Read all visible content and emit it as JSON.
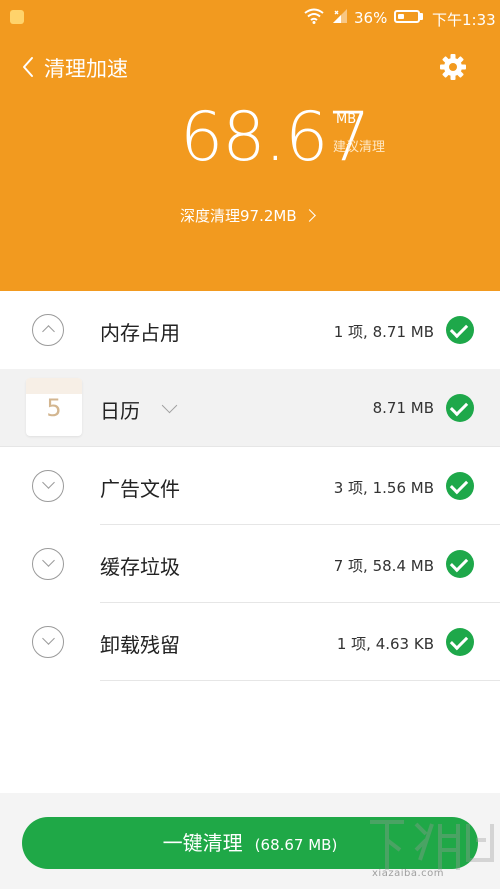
{
  "status_bar": {
    "battery": "36%",
    "battery_level": 0.36,
    "time": "下午1:33"
  },
  "header": {
    "title": "清理加速",
    "amount": "68.67",
    "unit": "MB",
    "suggestion": "建议清理",
    "deep_clean": "深度清理97.2MB"
  },
  "items": [
    {
      "label": "内存占用",
      "meta": "1 项, 8.71 MB",
      "expanded": true
    },
    {
      "label": "日历",
      "meta": "8.71  MB",
      "sub": true,
      "icon_text": "5"
    },
    {
      "label": "广告文件",
      "meta": "3 项, 1.56 MB"
    },
    {
      "label": "缓存垃圾",
      "meta": "7 项, 58.4 MB"
    },
    {
      "label": "卸载残留",
      "meta": "1 项, 4.63 KB"
    }
  ],
  "bottom": {
    "button_label": "一键清理",
    "button_size": "(68.67 MB)"
  },
  "watermark": {
    "site": "xiazaiba.com"
  },
  "colors": {
    "header_orange": "#f29a1f",
    "check_green": "#1ea84a",
    "button_green": "#1fa847"
  }
}
